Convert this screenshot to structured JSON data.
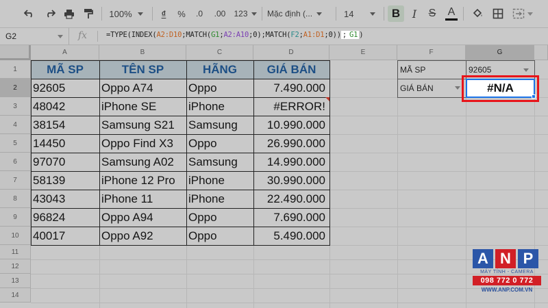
{
  "toolbar": {
    "zoom": "100%",
    "currency_symbol": "₫",
    "percent_symbol": "%",
    "decimal_decrease": ".0",
    "decimal_increase": ".00",
    "number_format": "123",
    "font_name": "Mặc định (...",
    "font_size": "14",
    "bold_label": "B",
    "italic_label": "I",
    "strike_label": "S",
    "text_color_label": "A",
    "text_color": "#000000"
  },
  "formula_bar": {
    "name_box": "G2",
    "fx_label": "fx",
    "formula": {
      "p1": "=TYPE(INDEX(",
      "r1": "A2:D10",
      "p2": ";MATCH(",
      "r2": "G1",
      "p3": ";",
      "r3": "A2:A10",
      "p4": ";0);MATCH(",
      "r4": "F2",
      "p5": ";",
      "r5": "A1:D1",
      "p6": ";0))",
      "p7": ";",
      "r6": "G1",
      "p8": ")"
    }
  },
  "columns": [
    "A",
    "B",
    "C",
    "D",
    "E",
    "F",
    "G"
  ],
  "rows": [
    "1",
    "2",
    "3",
    "4",
    "5",
    "6",
    "7",
    "8",
    "9",
    "10",
    "11",
    "12",
    "13",
    "14"
  ],
  "table": {
    "headers": [
      "MÃ SP",
      "TÊN SP",
      "HÃNG",
      "GIÁ BÁN"
    ],
    "rows": [
      [
        "92605",
        "Oppo A74",
        "Oppo",
        "7.490.000"
      ],
      [
        "48042",
        "iPhone SE",
        "iPhone",
        "#ERROR!"
      ],
      [
        "38154",
        "Samsung S21",
        "Samsung",
        "10.990.000"
      ],
      [
        "14450",
        "Oppo Find X3",
        "Oppo",
        "26.990.000"
      ],
      [
        "97070",
        "Samsung A02",
        "Samsung",
        "14.990.000"
      ],
      [
        "58139",
        "iPhone 12 Pro",
        "iPhone",
        "30.990.000"
      ],
      [
        "43043",
        "iPhone 11",
        "iPhone",
        "22.490.000"
      ],
      [
        "96824",
        "Oppo A94",
        "Oppo",
        "7.690.000"
      ],
      [
        "40017",
        "Oppo A92",
        "Oppo",
        "5.490.000"
      ]
    ]
  },
  "lookup": {
    "f1_label": "MÃ SP",
    "g1_value": "92605",
    "f2_label": "GIÁ BÁN",
    "g2_result": "#N/A"
  },
  "logo": {
    "letters": [
      "A",
      "N",
      "P"
    ],
    "tagline": "MÁY TÍNH - CAMERA",
    "phone": "098 772 0 772",
    "website": "WWW.ANP.COM.VN",
    "colors": [
      "#2b56a8",
      "#d21f26",
      "#2b56a8"
    ]
  },
  "colors": {
    "header_text": "#1d4f85",
    "header_fill": "#a7b3b9",
    "selection_border": "#1a73e8",
    "highlight_box": "#e8141a"
  }
}
